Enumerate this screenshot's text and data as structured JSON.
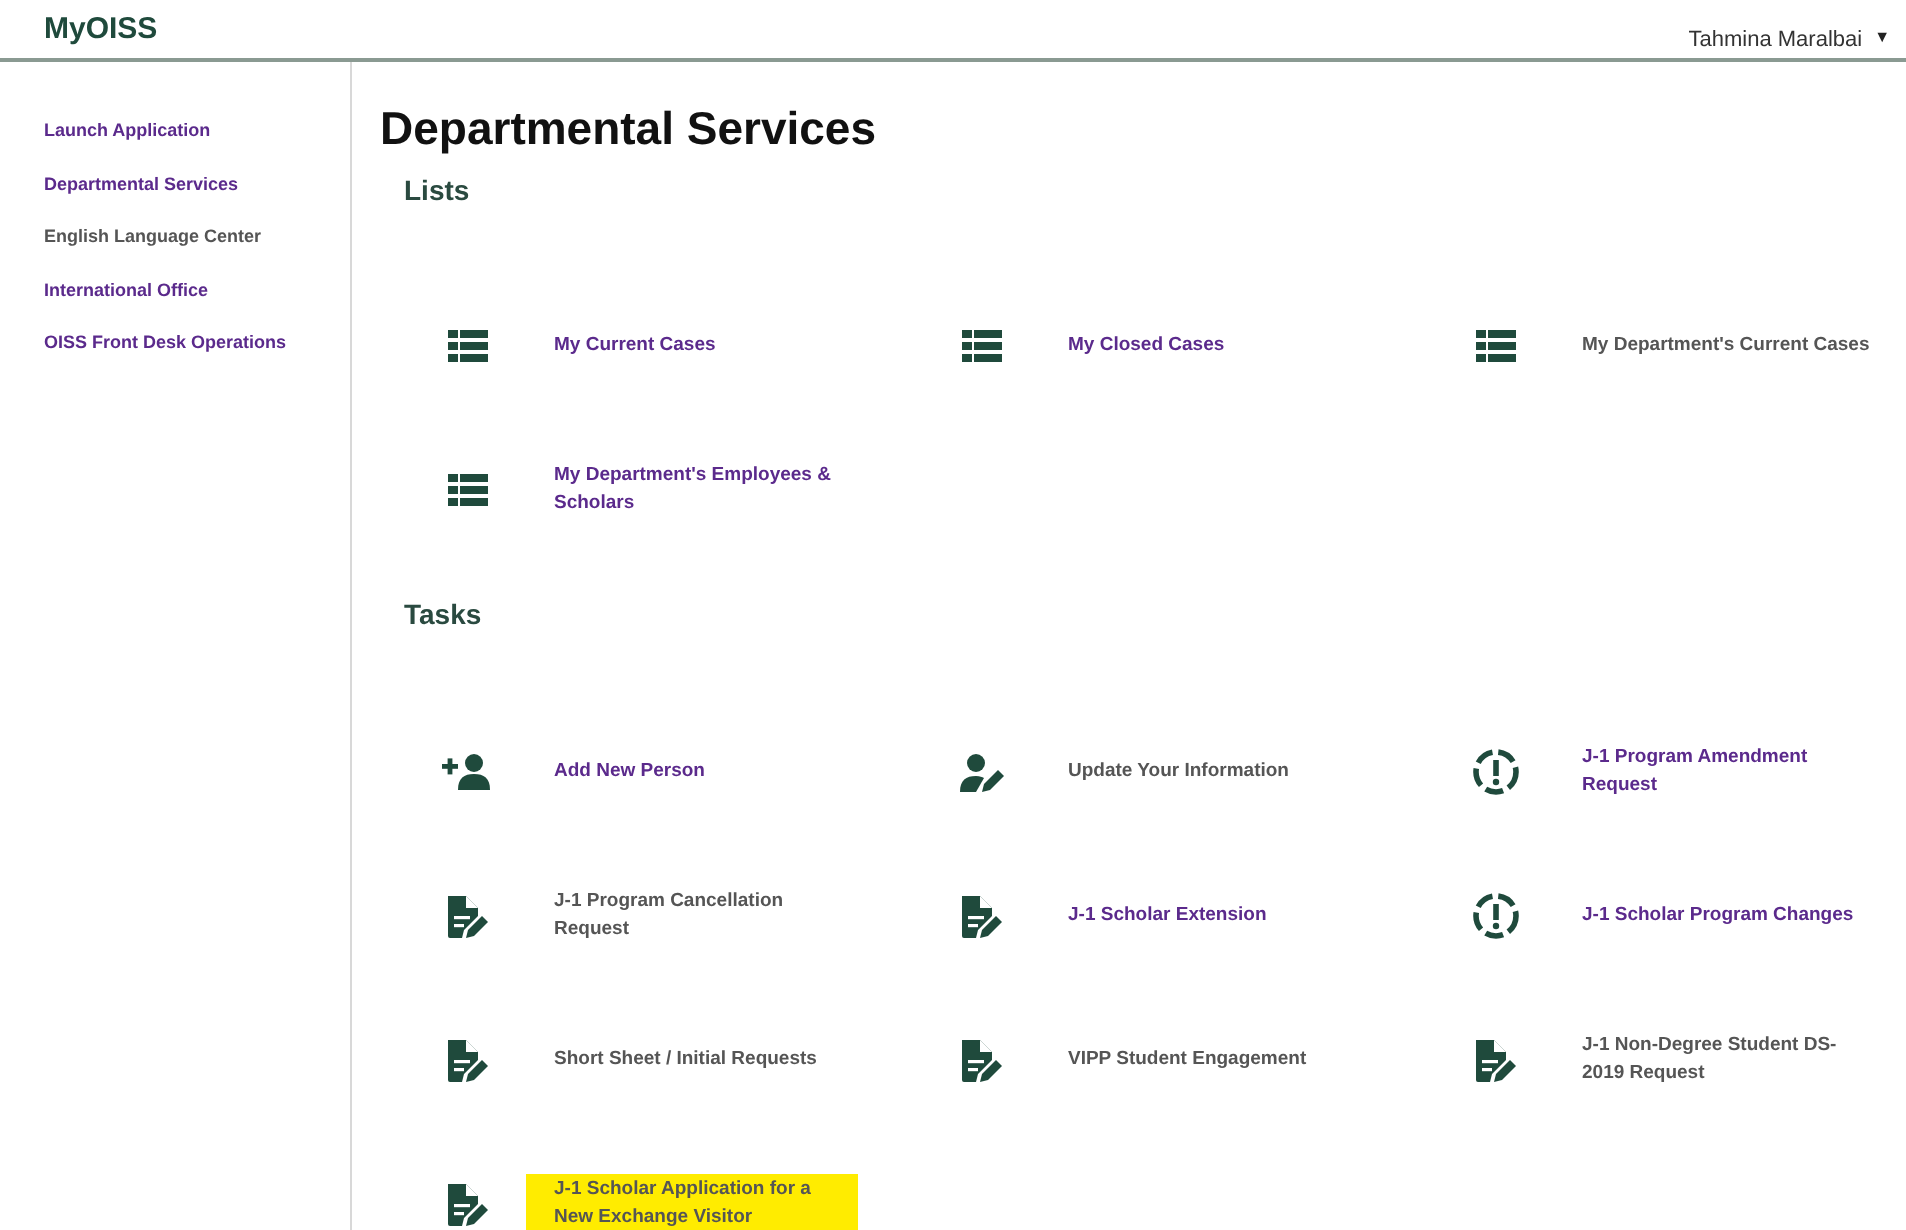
{
  "header": {
    "brand": "MyOISS",
    "user": "Tahmina Maralbai",
    "user_caret": "▼"
  },
  "sidebar": {
    "items": [
      {
        "label": "Launch Application",
        "visited": false
      },
      {
        "label": "Departmental Services",
        "visited": false
      },
      {
        "label": "English Language Center",
        "visited": true
      },
      {
        "label": "International Office",
        "visited": false
      },
      {
        "label": "OISS Front Desk Operations",
        "visited": false
      }
    ]
  },
  "page_title": "Departmental Services",
  "sections": [
    {
      "heading": "Lists",
      "items": [
        {
          "kind": "list",
          "label": "My Current Cases",
          "visited": false,
          "highlighted": false
        },
        {
          "kind": "list",
          "label": "My Closed Cases",
          "visited": false,
          "highlighted": false
        },
        {
          "kind": "list",
          "label": "My Department's Current Cases",
          "visited": true,
          "highlighted": false
        },
        {
          "kind": "list",
          "label": "My Department's Employees & Scholars",
          "visited": false,
          "highlighted": false
        }
      ]
    },
    {
      "heading": "Tasks",
      "items": [
        {
          "kind": "add-person",
          "label": "Add New Person",
          "visited": false,
          "highlighted": false
        },
        {
          "kind": "edit-person",
          "label": "Update Your Information",
          "visited": true,
          "highlighted": false
        },
        {
          "kind": "alert",
          "label": "J-1 Program Amendment Request",
          "visited": false,
          "highlighted": false
        },
        {
          "kind": "form",
          "label": "J-1 Program Cancellation Request",
          "visited": true,
          "highlighted": false
        },
        {
          "kind": "form",
          "label": "J-1 Scholar Extension",
          "visited": false,
          "highlighted": false
        },
        {
          "kind": "alert",
          "label": "J-1 Scholar Program Changes",
          "visited": false,
          "highlighted": false
        },
        {
          "kind": "form",
          "label": "Short Sheet / Initial Requests",
          "visited": true,
          "highlighted": false
        },
        {
          "kind": "form",
          "label": "VIPP Student Engagement",
          "visited": true,
          "highlighted": false
        },
        {
          "kind": "form",
          "label": "J-1 Non-Degree Student DS-2019 Request",
          "visited": true,
          "highlighted": false
        },
        {
          "kind": "form",
          "label": "J-1 Scholar Application for a New Exchange Visitor",
          "visited": true,
          "highlighted": true
        }
      ]
    }
  ]
}
